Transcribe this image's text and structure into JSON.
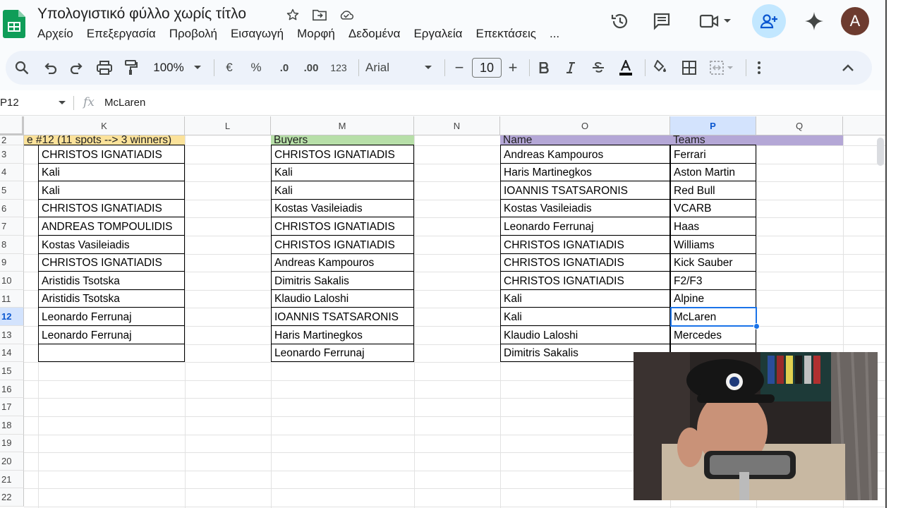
{
  "doc": {
    "title": "Υπολογιστικό φύλλο χωρίς τίτλο"
  },
  "menu": [
    "Αρχείο",
    "Επεξεργασία",
    "Προβολή",
    "Εισαγωγή",
    "Μορφή",
    "Δεδομένα",
    "Εργαλεία",
    "Επεκτάσεις",
    "..."
  ],
  "header": {
    "avatar_letter": "A"
  },
  "toolbar": {
    "zoom": "100%",
    "currency": "€",
    "percent": "%",
    "dec_decrease": ".0",
    "dec_increase": ".00",
    "number_format": "123",
    "font": "Arial",
    "font_size": "10",
    "minus": "−",
    "plus": "+"
  },
  "formula_bar": {
    "cell_ref": "P12",
    "fx": "fx",
    "value": "McLaren"
  },
  "columns": [
    "K",
    "L",
    "M",
    "N",
    "O",
    "P",
    "Q"
  ],
  "rows": [
    "2",
    "3",
    "4",
    "5",
    "6",
    "7",
    "8",
    "9",
    "10",
    "11",
    "12",
    "13",
    "14",
    "15",
    "16",
    "17",
    "18",
    "19",
    "20",
    "21",
    "22"
  ],
  "selected": {
    "column": "P",
    "row": "12"
  },
  "table_k": {
    "header": "e #12 (11 spots --> 3 winners)",
    "header_color": "#fbe29a",
    "values": [
      "CHRISTOS IGNATIADIS",
      "Kali",
      "Kali",
      "CHRISTOS IGNATIADIS",
      "ANDREAS TOMPOULIDIS",
      "Kostas Vasileiadis",
      "CHRISTOS IGNATIADIS",
      "Aristidis Tsotska",
      "Aristidis Tsotska",
      "Leonardo Ferrunaj",
      "Leonardo Ferrunaj",
      ""
    ]
  },
  "table_m": {
    "header": "Buyers",
    "header_color": "#b7dfa8",
    "values": [
      "CHRISTOS IGNATIADIS",
      "Kali",
      "Kali",
      "Kostas Vasileiadis",
      "CHRISTOS IGNATIADIS",
      "CHRISTOS IGNATIADIS",
      "Andreas Kampouros",
      "Dimitris Sakalis",
      "Klaudio Laloshi",
      "IOANNIS TSATSARONIS",
      "Haris Martinegkos",
      "Leonardo Ferrunaj"
    ]
  },
  "table_o": {
    "header": "Name",
    "header_color": "#b4a7d6",
    "values": [
      "Andreas Kampouros",
      "Haris Martinegkos",
      "IOANNIS TSATSARONIS",
      "Kostas Vasileiadis",
      "Leonardo Ferrunaj",
      "CHRISTOS IGNATIADIS",
      "CHRISTOS IGNATIADIS",
      "CHRISTOS IGNATIADIS",
      "Kali",
      "Kali",
      "Klaudio Laloshi",
      "Dimitris Sakalis"
    ]
  },
  "table_p": {
    "header": "Teams",
    "header_color": "#b4a7d6",
    "values": [
      "Ferrari",
      "Aston Martin",
      "Red Bull",
      "VCARB",
      "Haas",
      "Williams",
      "Kick Sauber",
      "F2/F3",
      "Alpine",
      "McLaren",
      "Mercedes",
      ""
    ]
  },
  "colors": {
    "accent": "#1a73e8",
    "share_bg": "#c2e7ff",
    "toolbar_bg": "#edf2fa"
  }
}
